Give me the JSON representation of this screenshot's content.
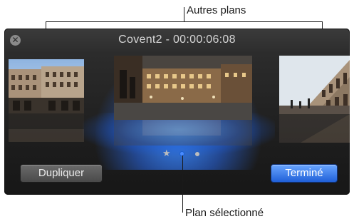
{
  "callouts": {
    "top": "Autres plans",
    "bottom": "Plan sélectionné"
  },
  "window": {
    "title": "Covent2 - 00:00:06:08",
    "close_glyph": "✕"
  },
  "clips": [
    {
      "name": "left-clip-thumbnail"
    },
    {
      "name": "selected-clip-thumbnail"
    },
    {
      "name": "right-clip-thumbnail"
    }
  ],
  "pager": {
    "star_glyph": "★",
    "selected_index": 1
  },
  "buttons": {
    "duplicate": "Dupliquer",
    "done": "Terminé"
  },
  "colors": {
    "accent": "#2f7bff",
    "panel": "#242424"
  }
}
